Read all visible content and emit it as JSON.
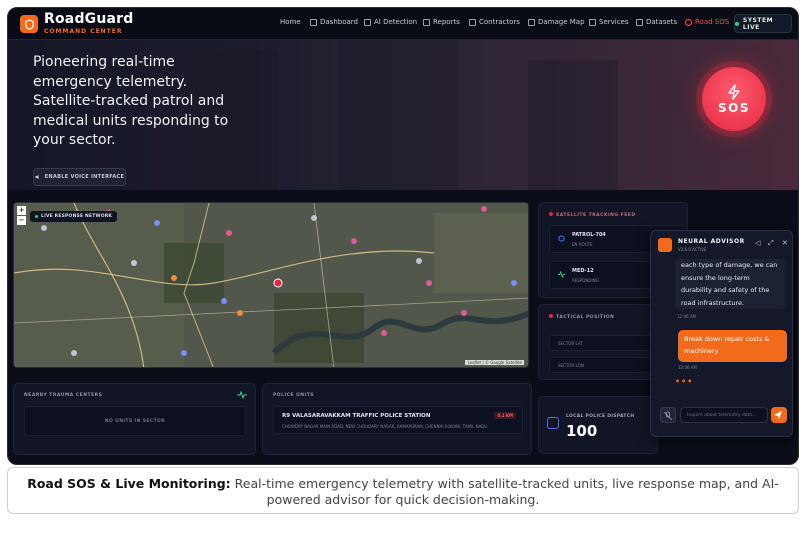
{
  "nav": {
    "brand": "RoadGuard",
    "brand_sub": "COMMAND CENTER",
    "items": [
      {
        "label": "Home"
      },
      {
        "label": "Dashboard"
      },
      {
        "label": "AI Detection"
      },
      {
        "label": "Reports"
      },
      {
        "label": "Contractors"
      },
      {
        "label": "Damage Map"
      },
      {
        "label": "Services"
      },
      {
        "label": "Datasets"
      },
      {
        "label": "Road SOS"
      }
    ],
    "status": "SYSTEM LIVE",
    "status_color": "#2fd37a",
    "accent_color": "#f26b1d"
  },
  "hero": {
    "headline": "Pioneering real-time emergency telemetry. Satellite-tracked patrol and medical units responding to your sector.",
    "voice_button": "ENABLE VOICE INTERFACE",
    "sos_label": "SOS",
    "sos_color": "#e5283f"
  },
  "map": {
    "tag": "LIVE RESPONSE NETWORK",
    "zoom_in": "+",
    "zoom_out": "−",
    "attribution": "Leaflet | © Google Satellite"
  },
  "trauma": {
    "title": "NEARBY TRAUMA CENTERS",
    "empty": "NO UNITS IN SECTOR"
  },
  "police": {
    "title": "POLICE UNITS",
    "station_name": "R9 VALASARAVAKKAM TRAFFIC POLICE STATION",
    "station_addr": "CHOWDRY NAGAR MAIN ROAD, NEW CHOUDARY NAGAR, RAMAPURAM, CHENNAI 600089, TAMIL NADU",
    "distance": "0.1 KM"
  },
  "satellite": {
    "title": "SATELLITE TRACKING FEED",
    "units": [
      {
        "name": "PATROL-704",
        "status": "EN ROUTE"
      },
      {
        "name": "MED-12",
        "status": "RESPONDING"
      }
    ]
  },
  "tactical": {
    "title": "TACTICAL POSITION",
    "lat_label": "SECTOR LAT",
    "lon_label": "SECTOR LON"
  },
  "dispatch": {
    "label": "LOCAL POLICE DISPATCH",
    "number": "100"
  },
  "advisor": {
    "title": "NEURAL ADVISOR",
    "version": "V2.6.0 ACTIVE",
    "bot_message": "each type of damage, we can ensure the long-term durability and safety of the road infrastructure.",
    "bot_time": "12:06 AM",
    "user_message": "Break down repair costs & machinery",
    "user_time": "12:06 AM",
    "typing": "•••",
    "input_placeholder": "Inquire about telemetry data..."
  },
  "caption": {
    "bold": "Road SOS & Live Monitoring:",
    "text": "Real-time emergency telemetry with satellite-tracked units, live response map, and AI-powered advisor for quick decision-making."
  }
}
